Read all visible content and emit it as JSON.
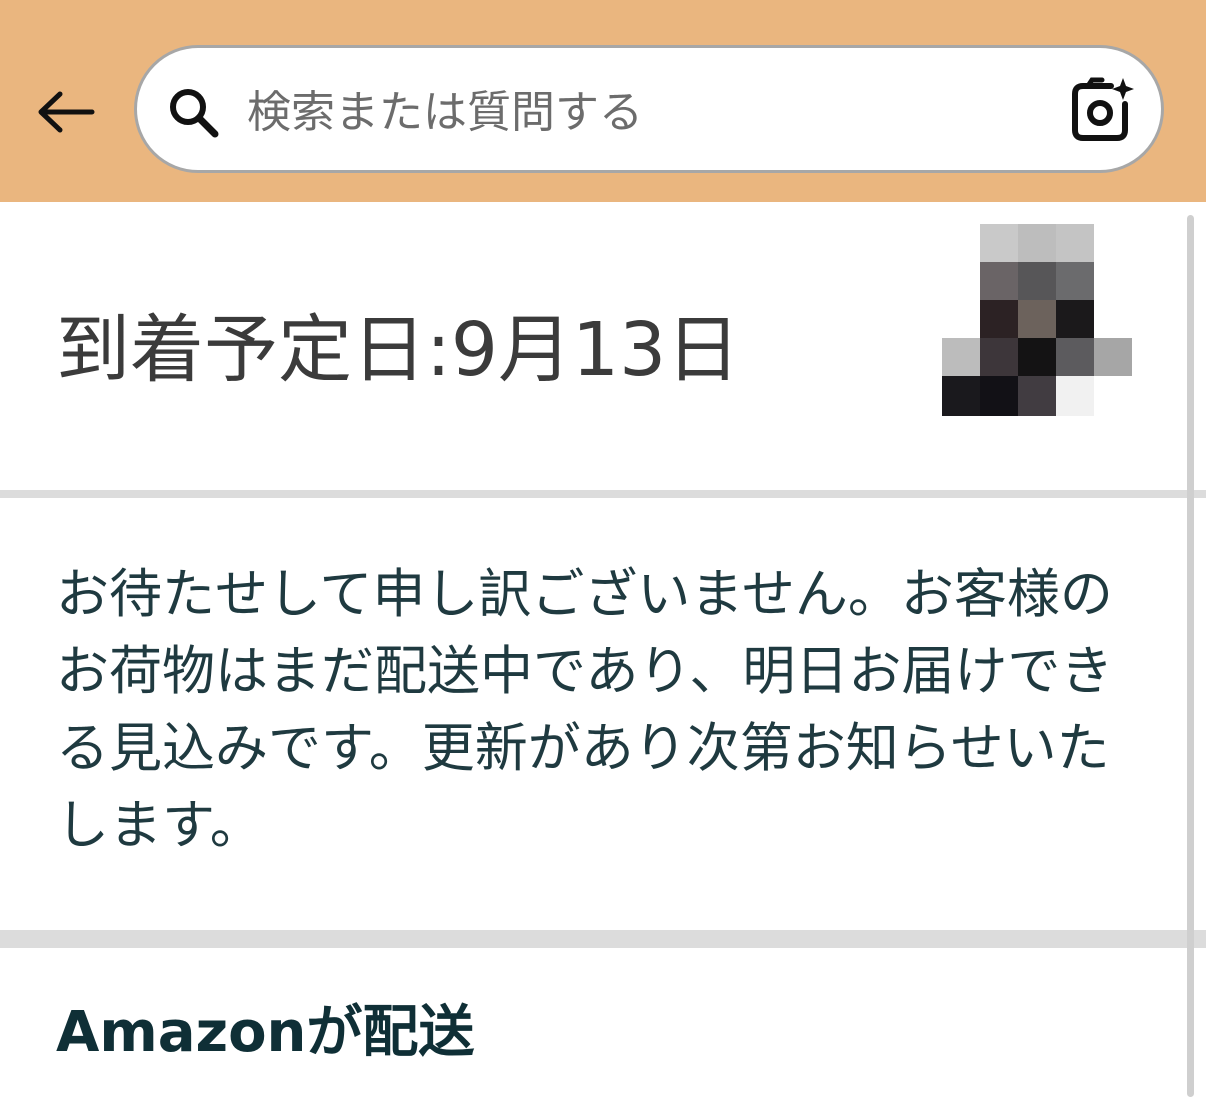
{
  "header": {
    "search": {
      "placeholder": "検索または質問する"
    },
    "back_icon": "arrow-left-icon",
    "search_icon": "magnifier-icon",
    "camera_icon": "camera-sparkle-icon",
    "background_color": "#eab67f"
  },
  "delivery": {
    "title": "到着予定日:9月13日",
    "notice": "お待たせして申し訳ございません。お客様のお荷物はまだ配送中であり、明日お届けできる見込みです。更新があり次第お知らせいたします。",
    "shipper": "Amazonが配送"
  },
  "colors": {
    "notice_text": "#1f3a40",
    "shipper_text": "#0f2f36",
    "divider": "#dcdcdc"
  }
}
